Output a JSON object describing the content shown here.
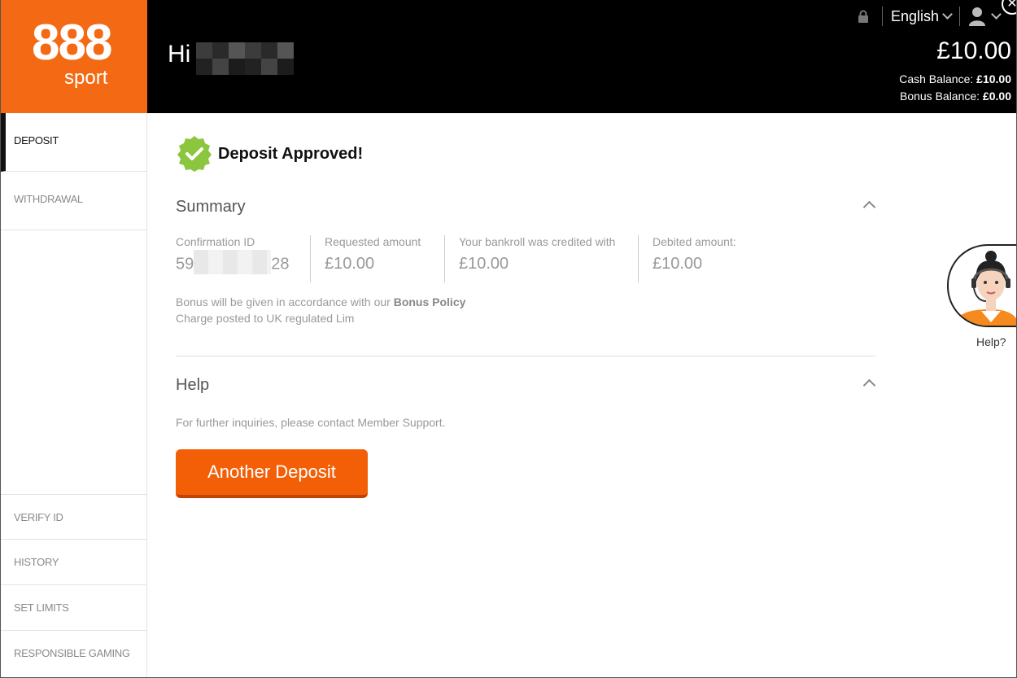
{
  "brand": {
    "logo_number": "888",
    "logo_word": "sport",
    "color": "#f46a14"
  },
  "header": {
    "greeting": "Hi",
    "language": "English",
    "balance": "£10.00",
    "cash_label": "Cash Balance:",
    "cash_value": "£10.00",
    "bonus_label": "Bonus Balance:",
    "bonus_value": "£0.00"
  },
  "sidebar": {
    "items": [
      {
        "label": "DEPOSIT"
      },
      {
        "label": "WITHDRAWAL"
      },
      {
        "label": "VERIFY ID"
      },
      {
        "label": "HISTORY"
      },
      {
        "label": "SET LIMITS"
      },
      {
        "label": "RESPONSIBLE GAMING"
      }
    ]
  },
  "main": {
    "status": "Deposit Approved!",
    "summary": {
      "title": "Summary",
      "confirmation_label": "Confirmation ID",
      "confirmation_prefix": "59",
      "confirmation_suffix": "28",
      "requested_label": "Requested amount",
      "requested_value": "£10.00",
      "credited_label": "Your bankroll was credited with",
      "credited_value": "£10.00",
      "debited_label": "Debited amount:",
      "debited_value": "£10.00",
      "bonus_note": "Bonus will be given in accordance with our",
      "bonus_policy": "Bonus Policy",
      "charge_note": "Charge posted to UK regulated Lim"
    },
    "help": {
      "title": "Help",
      "text": "For further inquiries, please contact Member Support."
    },
    "button_label": "Another Deposit"
  },
  "help_widget": {
    "label": "Help?"
  },
  "colors": {
    "accent": "#f35f07",
    "success": "#8cc63f"
  }
}
